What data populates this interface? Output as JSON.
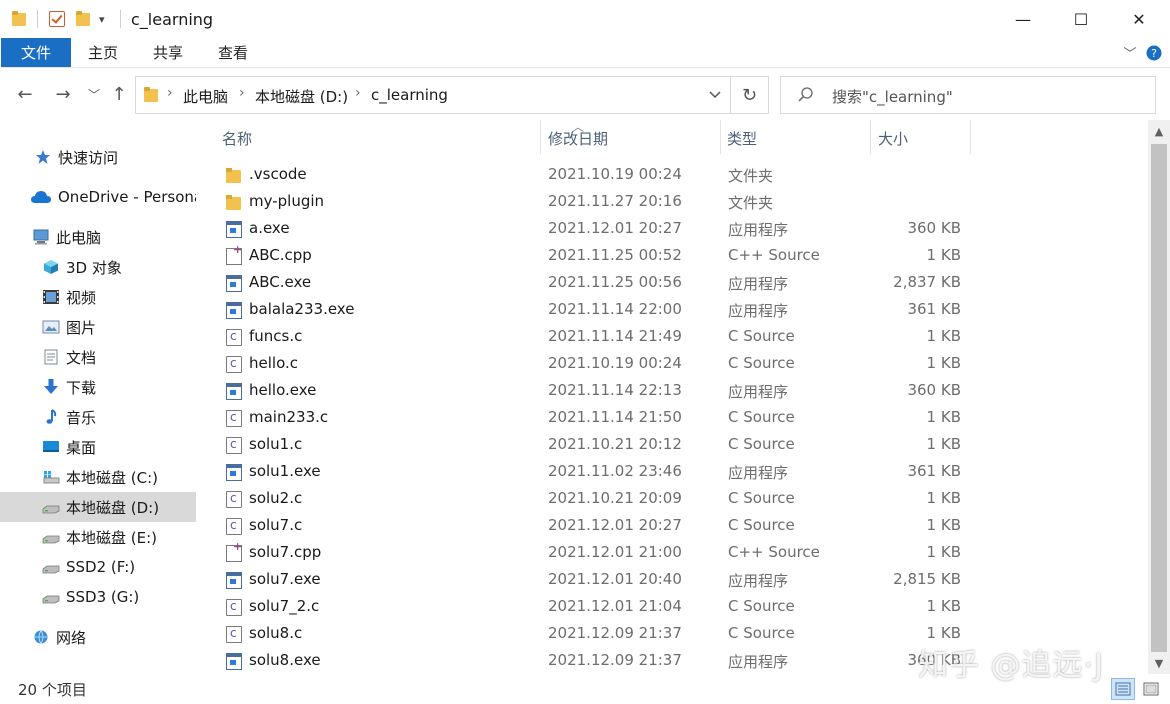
{
  "window": {
    "title": "c_learning",
    "minimize_glyph": "—",
    "maximize_glyph": "☐",
    "close_glyph": "✕"
  },
  "ribbon": {
    "tabs": [
      "文件",
      "主页",
      "共享",
      "查看"
    ]
  },
  "address": {
    "crumbs": [
      "此电脑",
      "本地磁盘 (D:)",
      "c_learning"
    ],
    "search_placeholder": "搜索\"c_learning\""
  },
  "sidebar": {
    "items": [
      {
        "label": "快速访问",
        "icon": "star-icon"
      },
      {
        "label": "OneDrive - Persona",
        "icon": "cloud-icon"
      },
      {
        "label": "此电脑",
        "icon": "computer-icon"
      },
      {
        "label": "3D 对象",
        "icon": "cube-3d-icon"
      },
      {
        "label": "视频",
        "icon": "film-icon"
      },
      {
        "label": "图片",
        "icon": "picture-icon"
      },
      {
        "label": "文档",
        "icon": "document-icon"
      },
      {
        "label": "下载",
        "icon": "download-arrow-icon"
      },
      {
        "label": "音乐",
        "icon": "music-note-icon"
      },
      {
        "label": "桌面",
        "icon": "desktop-icon"
      },
      {
        "label": "本地磁盘 (C:)",
        "icon": "windows-drive-icon"
      },
      {
        "label": "本地磁盘 (D:)",
        "icon": "drive-icon",
        "selected": true
      },
      {
        "label": "本地磁盘 (E:)",
        "icon": "drive-icon"
      },
      {
        "label": "SSD2 (F:)",
        "icon": "drive-icon"
      },
      {
        "label": "SSD3 (G:)",
        "icon": "drive-icon"
      },
      {
        "label": "网络",
        "icon": "network-icon"
      }
    ]
  },
  "columns": {
    "name": "名称",
    "date": "修改日期",
    "type": "类型",
    "size": "大小"
  },
  "files": [
    {
      "name": ".vscode",
      "date": "2021.10.19 00:24",
      "type": "文件夹",
      "size": "",
      "kind": "folder"
    },
    {
      "name": "my-plugin",
      "date": "2021.11.27 20:16",
      "type": "文件夹",
      "size": "",
      "kind": "folder"
    },
    {
      "name": "a.exe",
      "date": "2021.12.01 20:27",
      "type": "应用程序",
      "size": "360 KB",
      "kind": "exe"
    },
    {
      "name": "ABC.cpp",
      "date": "2021.11.25 00:52",
      "type": "C++ Source",
      "size": "1 KB",
      "kind": "cpp"
    },
    {
      "name": "ABC.exe",
      "date": "2021.11.25 00:56",
      "type": "应用程序",
      "size": "2,837 KB",
      "kind": "exe"
    },
    {
      "name": "balala233.exe",
      "date": "2021.11.14 22:00",
      "type": "应用程序",
      "size": "361 KB",
      "kind": "exe"
    },
    {
      "name": "funcs.c",
      "date": "2021.11.14 21:49",
      "type": "C Source",
      "size": "1 KB",
      "kind": "c"
    },
    {
      "name": "hello.c",
      "date": "2021.10.19 00:24",
      "type": "C Source",
      "size": "1 KB",
      "kind": "c"
    },
    {
      "name": "hello.exe",
      "date": "2021.11.14 22:13",
      "type": "应用程序",
      "size": "360 KB",
      "kind": "exe"
    },
    {
      "name": "main233.c",
      "date": "2021.11.14 21:50",
      "type": "C Source",
      "size": "1 KB",
      "kind": "c"
    },
    {
      "name": "solu1.c",
      "date": "2021.10.21 20:12",
      "type": "C Source",
      "size": "1 KB",
      "kind": "c"
    },
    {
      "name": "solu1.exe",
      "date": "2021.11.02 23:46",
      "type": "应用程序",
      "size": "361 KB",
      "kind": "exe"
    },
    {
      "name": "solu2.c",
      "date": "2021.10.21 20:09",
      "type": "C Source",
      "size": "1 KB",
      "kind": "c"
    },
    {
      "name": "solu7.c",
      "date": "2021.12.01 20:27",
      "type": "C Source",
      "size": "1 KB",
      "kind": "c"
    },
    {
      "name": "solu7.cpp",
      "date": "2021.12.01 21:00",
      "type": "C++ Source",
      "size": "1 KB",
      "kind": "cpp"
    },
    {
      "name": "solu7.exe",
      "date": "2021.12.01 20:40",
      "type": "应用程序",
      "size": "2,815 KB",
      "kind": "exe"
    },
    {
      "name": "solu7_2.c",
      "date": "2021.12.01 21:04",
      "type": "C Source",
      "size": "1 KB",
      "kind": "c"
    },
    {
      "name": "solu8.c",
      "date": "2021.12.09 21:37",
      "type": "C Source",
      "size": "1 KB",
      "kind": "c"
    },
    {
      "name": "solu8.exe",
      "date": "2021.12.09 21:37",
      "type": "应用程序",
      "size": "360 KB",
      "kind": "exe"
    }
  ],
  "status": {
    "count_text": "20 个项目"
  },
  "watermark": "知乎 @追远·J"
}
